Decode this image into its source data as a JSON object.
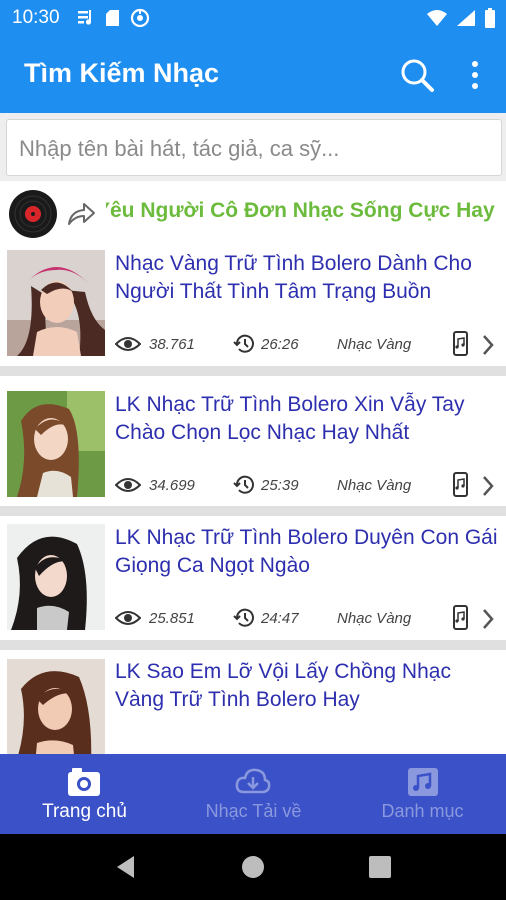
{
  "status_bar": {
    "time": "10:30"
  },
  "app_bar": {
    "title": "Tìm Kiếm Nhạc",
    "search_icon": "search-icon",
    "more_icon": "more-vert-icon"
  },
  "search": {
    "placeholder": "Nhập tên bài hát, tác giả, ca sỹ..."
  },
  "now_playing": {
    "title": "Yêu Người Cô Đơn Nhạc Sống Cực Hay",
    "accent": "#6dbb3d"
  },
  "songs": [
    {
      "title": "Nhạc Vàng Trữ Tình Bolero Dành Cho Người Thất Tình Tâm Trạng Buồn",
      "views": "38.761",
      "duration": "26:26",
      "genre": "Nhạc Vàng"
    },
    {
      "title": "LK Nhạc Trữ Tình Bolero Xin Vẫy Tay Chào Chọn Lọc Nhạc Hay Nhất",
      "views": "34.699",
      "duration": "25:39",
      "genre": "Nhạc Vàng"
    },
    {
      "title": "LK Nhạc Trữ Tình Bolero Duyên Con Gái Giọng Ca Ngọt Ngào",
      "views": "25.851",
      "duration": "24:47",
      "genre": "Nhạc Vàng"
    },
    {
      "title": "LK Sao Em Lỡ Vội Lấy Chồng Nhạc Vàng Trữ Tình Bolero Hay",
      "views": "",
      "duration": "",
      "genre": ""
    }
  ],
  "bottom_nav": {
    "items": [
      {
        "label": "Trang chủ",
        "icon": "home-photo-icon",
        "active": true
      },
      {
        "label": "Nhạc Tải về",
        "icon": "cloud-download-icon",
        "active": false
      },
      {
        "label": "Danh mục",
        "icon": "music-library-icon",
        "active": false
      }
    ]
  },
  "colors": {
    "primary": "#1f8ef1",
    "title_text": "#2d2fae",
    "bottom_nav": "#3b51c7"
  }
}
